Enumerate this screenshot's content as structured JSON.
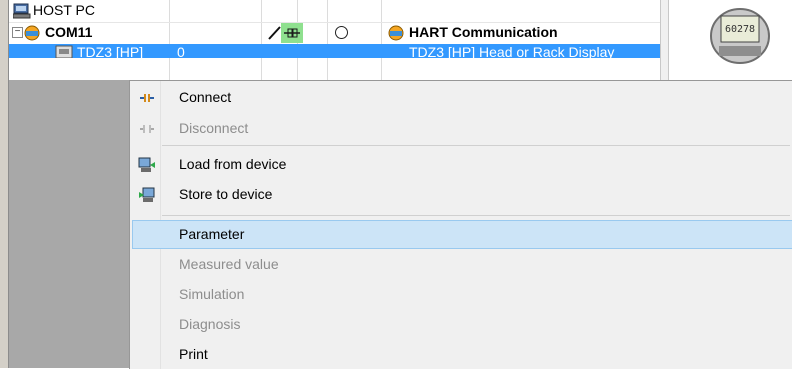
{
  "tree": {
    "rows": [
      {
        "label": "HOST PC"
      },
      {
        "label": "COM11",
        "status_label": "HART Communication"
      },
      {
        "label": "TDZ3 [HP]",
        "col2": "0",
        "desc": "TDZ3 [HP] Head or Rack Display"
      }
    ],
    "device_display_value": "60278"
  },
  "menu": {
    "items": [
      {
        "label": "Connect",
        "enabled": true,
        "icon": "connect-icon"
      },
      {
        "label": "Disconnect",
        "enabled": false,
        "icon": "disconnect-icon"
      },
      {
        "label": "Load from device",
        "enabled": true,
        "icon": "load-from-device-icon"
      },
      {
        "label": "Store to device",
        "enabled": true,
        "icon": "store-to-device-icon"
      },
      {
        "label": "Parameter",
        "enabled": true,
        "highlighted": true
      },
      {
        "label": "Measured value",
        "enabled": false
      },
      {
        "label": "Simulation",
        "enabled": false
      },
      {
        "label": "Diagnosis",
        "enabled": false
      },
      {
        "label": "Print",
        "enabled": true
      }
    ]
  },
  "colors": {
    "selection": "#3399ff",
    "menu_highlight": "#cce4f7",
    "connected_status": "#2ea84a"
  }
}
